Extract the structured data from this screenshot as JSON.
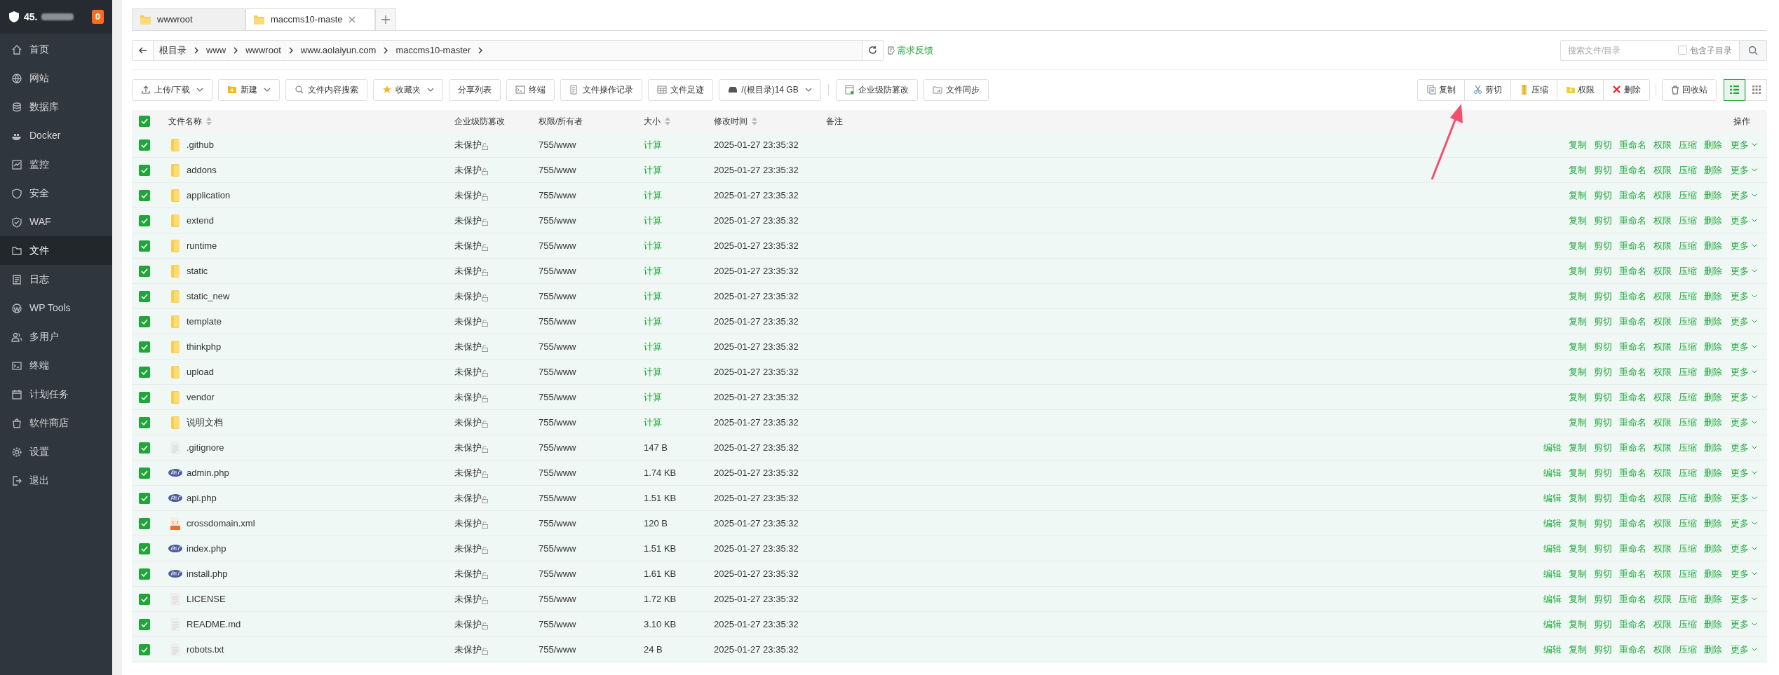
{
  "sidebar": {
    "server": "45.",
    "badge": "0",
    "items": [
      {
        "label": "首页",
        "selected": false
      },
      {
        "label": "网站",
        "selected": false
      },
      {
        "label": "数据库",
        "selected": false
      },
      {
        "label": "Docker",
        "selected": false
      },
      {
        "label": "监控",
        "selected": false
      },
      {
        "label": "安全",
        "selected": false
      },
      {
        "label": "WAF",
        "selected": false
      },
      {
        "label": "文件",
        "selected": true
      },
      {
        "label": "日志",
        "selected": false
      },
      {
        "label": "WP Tools",
        "selected": false
      },
      {
        "label": "多用户",
        "selected": false
      },
      {
        "label": "终端",
        "selected": false
      },
      {
        "label": "计划任务",
        "selected": false
      },
      {
        "label": "软件商店",
        "selected": false
      },
      {
        "label": "设置",
        "selected": false
      },
      {
        "label": "退出",
        "selected": false
      }
    ]
  },
  "tabs": [
    {
      "label": "wwwroot",
      "selected": false
    },
    {
      "label": "maccms10-maste",
      "selected": true
    }
  ],
  "breadcrumb": [
    "根目录",
    "www",
    "wwwroot",
    "www.aolaiyun.com",
    "maccms10-master"
  ],
  "feedback": "需求反馈",
  "search": {
    "placeholder": "搜索文件/目录",
    "include_subdirs": {
      "label": "包含子目录",
      "checked": false
    }
  },
  "toolbar": [
    {
      "label": "上传/下载",
      "dropdown": true
    },
    {
      "label": "新建",
      "dropdown": true
    },
    {
      "label": "文件内容搜索",
      "dropdown": false
    },
    {
      "label": "收藏夹",
      "dropdown": true
    },
    {
      "label": "分享列表",
      "dropdown": false
    },
    {
      "label": "终端",
      "dropdown": false
    },
    {
      "label": "文件操作记录",
      "dropdown": false
    },
    {
      "label": "文件足迹",
      "dropdown": false
    },
    {
      "label": "/(根目录)14 GB",
      "dropdown": true
    },
    {
      "label": "企业级防篡改",
      "dropdown": false
    },
    {
      "label": "文件同步",
      "dropdown": false
    }
  ],
  "batch_actions": [
    "复制",
    "剪切",
    "压缩",
    "权限",
    "删除"
  ],
  "recycle_bin": "回收站",
  "view_modes": [
    {
      "kind": "list",
      "selected": true
    },
    {
      "kind": "grid",
      "selected": false
    }
  ],
  "table": {
    "all_checked": true,
    "columns": [
      {
        "label": "文件名称",
        "sortable": true
      },
      {
        "label": "企业级防篡改",
        "sortable": false
      },
      {
        "label": "权限/所有者",
        "sortable": false
      },
      {
        "label": "大小",
        "sortable": true
      },
      {
        "label": "修改时间",
        "sortable": true
      },
      {
        "label": "备注",
        "sortable": false
      },
      {
        "label": "操作",
        "sortable": false
      }
    ],
    "rows": [
      {
        "kind": "folder",
        "checked": true,
        "name": ".github",
        "protection": "未保护",
        "perms": "755/www",
        "size": "计算",
        "size_is_link": true,
        "modified": "2025-01-27 23:35:32",
        "actions": [
          "复制",
          "剪切",
          "重命名",
          "权限",
          "压缩",
          "删除"
        ],
        "more": "更多"
      },
      {
        "kind": "folder",
        "checked": true,
        "name": "addons",
        "protection": "未保护",
        "perms": "755/www",
        "size": "计算",
        "size_is_link": true,
        "modified": "2025-01-27 23:35:32",
        "actions": [
          "复制",
          "剪切",
          "重命名",
          "权限",
          "压缩",
          "删除"
        ],
        "more": "更多"
      },
      {
        "kind": "folder",
        "checked": true,
        "name": "application",
        "protection": "未保护",
        "perms": "755/www",
        "size": "计算",
        "size_is_link": true,
        "modified": "2025-01-27 23:35:32",
        "actions": [
          "复制",
          "剪切",
          "重命名",
          "权限",
          "压缩",
          "删除"
        ],
        "more": "更多"
      },
      {
        "kind": "folder",
        "checked": true,
        "name": "extend",
        "protection": "未保护",
        "perms": "755/www",
        "size": "计算",
        "size_is_link": true,
        "modified": "2025-01-27 23:35:32",
        "actions": [
          "复制",
          "剪切",
          "重命名",
          "权限",
          "压缩",
          "删除"
        ],
        "more": "更多"
      },
      {
        "kind": "folder",
        "checked": true,
        "name": "runtime",
        "protection": "未保护",
        "perms": "755/www",
        "size": "计算",
        "size_is_link": true,
        "modified": "2025-01-27 23:35:32",
        "actions": [
          "复制",
          "剪切",
          "重命名",
          "权限",
          "压缩",
          "删除"
        ],
        "more": "更多"
      },
      {
        "kind": "folder",
        "checked": true,
        "name": "static",
        "protection": "未保护",
        "perms": "755/www",
        "size": "计算",
        "size_is_link": true,
        "modified": "2025-01-27 23:35:32",
        "actions": [
          "复制",
          "剪切",
          "重命名",
          "权限",
          "压缩",
          "删除"
        ],
        "more": "更多"
      },
      {
        "kind": "folder",
        "checked": true,
        "name": "static_new",
        "protection": "未保护",
        "perms": "755/www",
        "size": "计算",
        "size_is_link": true,
        "modified": "2025-01-27 23:35:32",
        "actions": [
          "复制",
          "剪切",
          "重命名",
          "权限",
          "压缩",
          "删除"
        ],
        "more": "更多"
      },
      {
        "kind": "folder",
        "checked": true,
        "name": "template",
        "protection": "未保护",
        "perms": "755/www",
        "size": "计算",
        "size_is_link": true,
        "modified": "2025-01-27 23:35:32",
        "actions": [
          "复制",
          "剪切",
          "重命名",
          "权限",
          "压缩",
          "删除"
        ],
        "more": "更多"
      },
      {
        "kind": "folder",
        "checked": true,
        "name": "thinkphp",
        "protection": "未保护",
        "perms": "755/www",
        "size": "计算",
        "size_is_link": true,
        "modified": "2025-01-27 23:35:32",
        "actions": [
          "复制",
          "剪切",
          "重命名",
          "权限",
          "压缩",
          "删除"
        ],
        "more": "更多"
      },
      {
        "kind": "folder",
        "checked": true,
        "name": "upload",
        "protection": "未保护",
        "perms": "755/www",
        "size": "计算",
        "size_is_link": true,
        "modified": "2025-01-27 23:35:32",
        "actions": [
          "复制",
          "剪切",
          "重命名",
          "权限",
          "压缩",
          "删除"
        ],
        "more": "更多"
      },
      {
        "kind": "folder",
        "checked": true,
        "name": "vendor",
        "protection": "未保护",
        "perms": "755/www",
        "size": "计算",
        "size_is_link": true,
        "modified": "2025-01-27 23:35:32",
        "actions": [
          "复制",
          "剪切",
          "重命名",
          "权限",
          "压缩",
          "删除"
        ],
        "more": "更多"
      },
      {
        "kind": "folder",
        "checked": true,
        "name": "说明文档",
        "protection": "未保护",
        "perms": "755/www",
        "size": "计算",
        "size_is_link": true,
        "modified": "2025-01-27 23:35:32",
        "actions": [
          "复制",
          "剪切",
          "重命名",
          "权限",
          "压缩",
          "删除"
        ],
        "more": "更多"
      },
      {
        "kind": "file",
        "checked": true,
        "name": ".gitignore",
        "protection": "未保护",
        "perms": "755/www",
        "size": "147 B",
        "size_is_link": false,
        "modified": "2025-01-27 23:35:32",
        "actions": [
          "编辑",
          "复制",
          "剪切",
          "重命名",
          "权限",
          "压缩",
          "删除"
        ],
        "more": "更多"
      },
      {
        "kind": "php",
        "checked": true,
        "name": "admin.php",
        "protection": "未保护",
        "perms": "755/www",
        "size": "1.74 KB",
        "size_is_link": false,
        "modified": "2025-01-27 23:35:32",
        "actions": [
          "编辑",
          "复制",
          "剪切",
          "重命名",
          "权限",
          "压缩",
          "删除"
        ],
        "more": "更多"
      },
      {
        "kind": "php",
        "checked": true,
        "name": "api.php",
        "protection": "未保护",
        "perms": "755/www",
        "size": "1.51 KB",
        "size_is_link": false,
        "modified": "2025-01-27 23:35:32",
        "actions": [
          "编辑",
          "复制",
          "剪切",
          "重命名",
          "权限",
          "压缩",
          "删除"
        ],
        "more": "更多"
      },
      {
        "kind": "xml",
        "checked": true,
        "name": "crossdomain.xml",
        "protection": "未保护",
        "perms": "755/www",
        "size": "120 B",
        "size_is_link": false,
        "modified": "2025-01-27 23:35:32",
        "actions": [
          "编辑",
          "复制",
          "剪切",
          "重命名",
          "权限",
          "压缩",
          "删除"
        ],
        "more": "更多"
      },
      {
        "kind": "php",
        "checked": true,
        "name": "index.php",
        "protection": "未保护",
        "perms": "755/www",
        "size": "1.51 KB",
        "size_is_link": false,
        "modified": "2025-01-27 23:35:32",
        "actions": [
          "编辑",
          "复制",
          "剪切",
          "重命名",
          "权限",
          "压缩",
          "删除"
        ],
        "more": "更多"
      },
      {
        "kind": "php",
        "checked": true,
        "name": "install.php",
        "protection": "未保护",
        "perms": "755/www",
        "size": "1.61 KB",
        "size_is_link": false,
        "modified": "2025-01-27 23:35:32",
        "actions": [
          "编辑",
          "复制",
          "剪切",
          "重命名",
          "权限",
          "压缩",
          "删除"
        ],
        "more": "更多"
      },
      {
        "kind": "file",
        "checked": true,
        "name": "LICENSE",
        "protection": "未保护",
        "perms": "755/www",
        "size": "1.72 KB",
        "size_is_link": false,
        "modified": "2025-01-27 23:35:32",
        "actions": [
          "编辑",
          "复制",
          "剪切",
          "重命名",
          "权限",
          "压缩",
          "删除"
        ],
        "more": "更多"
      },
      {
        "kind": "file",
        "checked": true,
        "name": "README.md",
        "protection": "未保护",
        "perms": "755/www",
        "size": "3.10 KB",
        "size_is_link": false,
        "modified": "2025-01-27 23:35:32",
        "actions": [
          "编辑",
          "复制",
          "剪切",
          "重命名",
          "权限",
          "压缩",
          "删除"
        ],
        "more": "更多"
      },
      {
        "kind": "file",
        "checked": true,
        "name": "robots.txt",
        "protection": "未保护",
        "perms": "755/www",
        "size": "24 B",
        "size_is_link": false,
        "modified": "2025-01-27 23:35:32",
        "actions": [
          "编辑",
          "复制",
          "剪切",
          "重命名",
          "权限",
          "压缩",
          "删除"
        ],
        "more": "更多"
      }
    ]
  }
}
